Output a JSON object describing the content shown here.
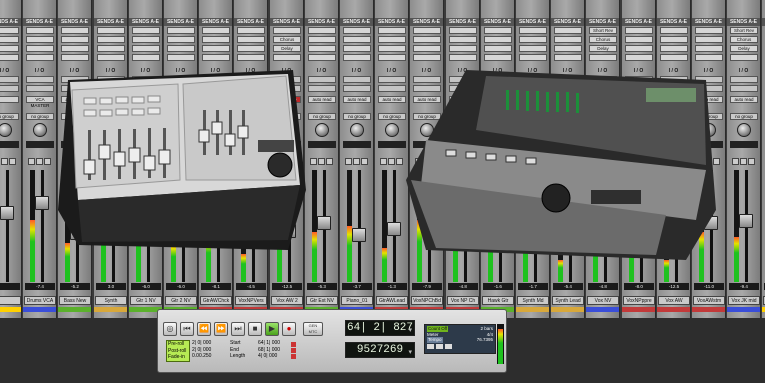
{
  "mixer": {
    "sends_header": "SENDS A-E",
    "io_label": "I / O",
    "auto_label": "AUTO",
    "group_label": "no group",
    "channels": [
      {
        "name": "",
        "sends": [
          "",
          "",
          "",
          ""
        ],
        "auto": "",
        "vol": "",
        "color": "#ffd000"
      },
      {
        "name": "Drums VCA",
        "sends": [
          "",
          "",
          "",
          ""
        ],
        "auto": "VCA MASTER",
        "vol": "-7.4",
        "color": "#3a4ed8"
      },
      {
        "name": "Bass New",
        "sends": [
          "",
          "",
          "",
          ""
        ],
        "auto": "auto read",
        "vol": "-5.2",
        "color": "#5bb12c"
      },
      {
        "name": "Synth",
        "sends": [
          "",
          "",
          "",
          ""
        ],
        "auto": "auto read",
        "vol": "3.0",
        "color": "#d8a83b"
      },
      {
        "name": "Gtr 1 NV",
        "sends": [
          "",
          "",
          "",
          ""
        ],
        "auto": "auto read",
        "vol": "-6.0",
        "color": "#5bb12c"
      },
      {
        "name": "Gtr 2 NV",
        "sends": [
          "",
          "",
          "",
          ""
        ],
        "auto": "auto read",
        "vol": "-6.0",
        "color": "#5bb12c"
      },
      {
        "name": "GtrAWChck",
        "sends": [
          "",
          "",
          "",
          ""
        ],
        "auto": "auto read",
        "vol": "-8.1",
        "color": "#c23a3a"
      },
      {
        "name": "VoxNPVers",
        "sends": [
          "",
          "",
          "",
          ""
        ],
        "auto": "auto read",
        "vol": "-4.5",
        "color": "#c23a3a"
      },
      {
        "name": "Vox AW 2",
        "sends": [
          "",
          "Chorus",
          "Delay",
          ""
        ],
        "auto": "auto write",
        "vol": "-12.5",
        "color": "#c23a3a"
      },
      {
        "name": "Gtr Ext NV",
        "sends": [
          "",
          "",
          "",
          ""
        ],
        "auto": "auto read",
        "vol": "-5.3",
        "color": "#5bb12c"
      },
      {
        "name": "Piano_01",
        "sends": [
          "",
          "",
          "",
          ""
        ],
        "auto": "auto read",
        "vol": "-3.7",
        "color": "#3a4ed8"
      },
      {
        "name": "GtrAWLead",
        "sends": [
          "",
          "",
          "",
          ""
        ],
        "auto": "auto read",
        "vol": "-1.3",
        "color": "#c23a3a"
      },
      {
        "name": "VoxNPChBd",
        "sends": [
          "",
          "",
          "",
          ""
        ],
        "auto": "auto read",
        "vol": "-7.9",
        "color": "#c23a3a"
      },
      {
        "name": "Vox NP Ch",
        "sends": [
          "",
          "",
          "",
          ""
        ],
        "auto": "auto read",
        "vol": "-4.8",
        "color": "#c23a3a"
      },
      {
        "name": "Hawk Gtr",
        "sends": [
          "",
          "",
          "",
          ""
        ],
        "auto": "auto read",
        "vol": "-1.6",
        "color": "#5bb12c"
      },
      {
        "name": "Synth Md",
        "sends": [
          "",
          "",
          "",
          ""
        ],
        "auto": "auto read",
        "vol": "-1.7",
        "color": "#d8a83b"
      },
      {
        "name": "Synth Lead",
        "sends": [
          "",
          "",
          "",
          ""
        ],
        "auto": "auto read",
        "vol": "-5.4",
        "color": "#d8a83b"
      },
      {
        "name": "Vox NV",
        "sends": [
          "Short Rev",
          "Chorus",
          "Delay",
          ""
        ],
        "auto": "auto read",
        "vol": "-4.8",
        "color": "#3a4ed8"
      },
      {
        "name": "VoxNPppre",
        "sends": [
          "",
          "",
          "",
          ""
        ],
        "auto": "auto read",
        "vol": "-8.0",
        "color": "#c23a3a"
      },
      {
        "name": "Vox AW",
        "sends": [
          "",
          "",
          "",
          ""
        ],
        "auto": "auto read",
        "vol": "-12.5",
        "color": "#c23a3a"
      },
      {
        "name": "VoxAWstm",
        "sends": [
          "",
          "",
          "",
          ""
        ],
        "auto": "auto read",
        "vol": "-11.0",
        "color": "#c23a3a"
      },
      {
        "name": "Vox JK mid",
        "sends": [
          "Short Rev",
          "Chorus",
          "Delay",
          ""
        ],
        "auto": "auto read",
        "vol": "-9.4",
        "color": "#3a4ed8"
      },
      {
        "name": "",
        "sends": [
          "",
          "",
          "",
          ""
        ],
        "auto": "",
        "vol": "",
        "color": "#ffd000"
      }
    ]
  },
  "transport": {
    "main_counter": "64| 2| 827",
    "sub_counter": "9527269",
    "pre_roll": "Pre-roll",
    "post_roll": "Post-roll",
    "fade_in": "Fade-in",
    "start_label": "Start",
    "end_label": "End",
    "length_label": "Length",
    "pre_val": "2| 0| 000",
    "post_val": "2| 0| 000",
    "fade_val": "0.00.250",
    "start_val": "64| 1| 000",
    "end_val": "68| 1| 000",
    "length_val": "4| 0| 000",
    "mini": {
      "count_off": "Count Off",
      "meter": "Meter",
      "tempo": "Tempo",
      "bars": "2 bars",
      "sig": "4/4",
      "bpm": "76.7395"
    }
  }
}
